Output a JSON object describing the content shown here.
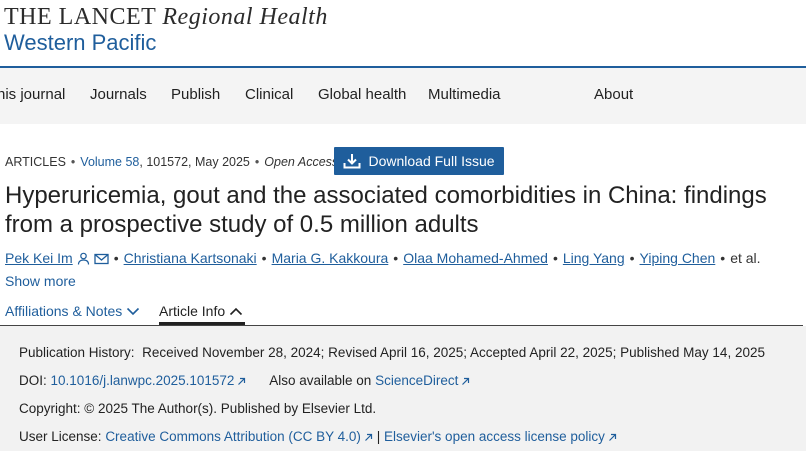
{
  "header": {
    "logo_line1_main": "THE LANCET",
    "logo_line1_italic": "Regional Health",
    "logo_line2": "Western Pacific"
  },
  "nav": {
    "items": [
      "his journal",
      "Journals",
      "Publish",
      "Clinical",
      "Global health",
      "Multimedia",
      "About"
    ]
  },
  "article": {
    "type": "ARTICLES",
    "volume": "Volume 58",
    "article_no_date": ", 101572, May 2025",
    "access": "Open Access",
    "download_label": "Download Full Issue",
    "title": "Hyperuricemia, gout and the associated comorbidities in China: findings from a prospective study of 0.5 million adults",
    "authors": [
      "Pek Kei Im",
      "Christiana Kartsonaki",
      "Maria G. Kakkoura",
      "Olaa Mohamed-Ahmed",
      "Ling Yang",
      "Yiping Chen"
    ],
    "et_al": "et al.",
    "show_more": "Show more"
  },
  "tabs": {
    "affiliations": "Affiliations & Notes",
    "article_info": "Article Info"
  },
  "info": {
    "history_label": "Publication History:",
    "history_value": "Received November 28, 2024; Revised April 16, 2025; Accepted April 22, 2025; Published May 14, 2025",
    "doi_label": "DOI:",
    "doi_value": "10.1016/j.lanwpc.2025.101572",
    "also_label": "Also available on",
    "also_value": "ScienceDirect",
    "copyright": "Copyright: © 2025 The Author(s). Published by Elsevier Ltd.",
    "license_label": "User License:",
    "license_value": "Creative Commons Attribution (CC BY 4.0)",
    "license_sep": "|",
    "policy_value": "Elsevier's open access license policy"
  },
  "colors": {
    "accent": "#1f5e9c",
    "nav_bg": "#f4f4f4",
    "panel_bg": "#f2f2f2"
  },
  "icons": [
    "person-icon",
    "email-icon",
    "download-icon",
    "chevron-down-icon",
    "chevron-up-icon",
    "external-link-icon"
  ]
}
